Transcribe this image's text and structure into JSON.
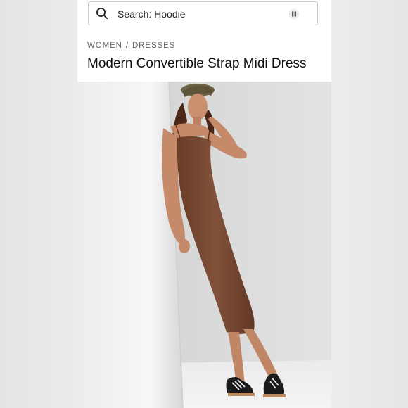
{
  "search": {
    "text": "Search: Hoodie"
  },
  "breadcrumb": {
    "items": [
      "WOMEN",
      "DRESSES"
    ],
    "separator": "/"
  },
  "product": {
    "title": "Modern Convertible Strap Midi Dress",
    "dress_color": "#7a4a30"
  },
  "icons": {
    "search": "search-icon",
    "pause": "pause-icon"
  }
}
